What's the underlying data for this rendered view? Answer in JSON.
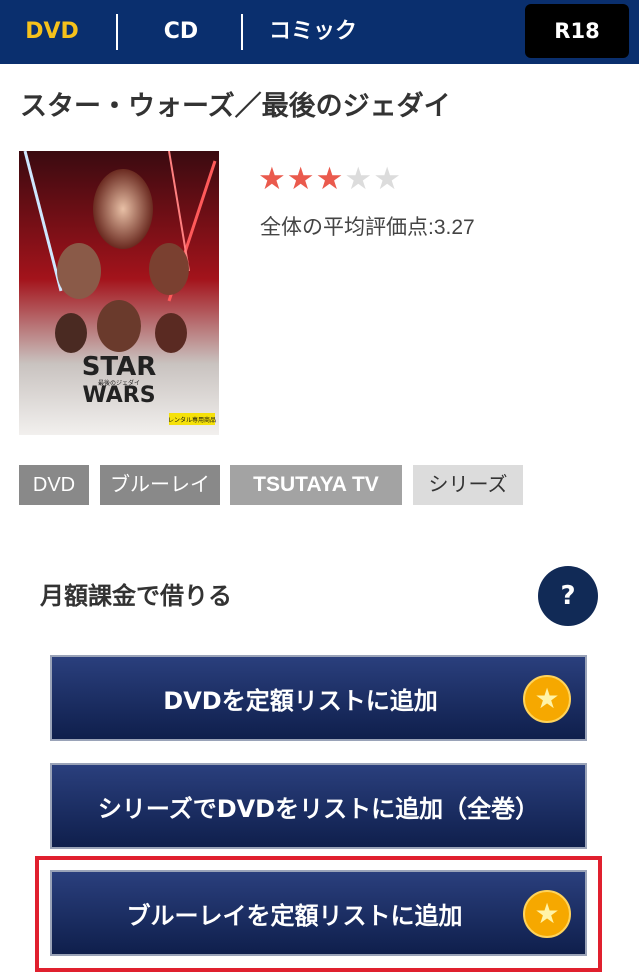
{
  "nav": {
    "tabs": [
      {
        "label": "DVD",
        "active": true
      },
      {
        "label": "CD",
        "active": false
      },
      {
        "label": "コミック",
        "active": false
      }
    ],
    "r18_label": "R18",
    "active_color": "#f6c21b",
    "bar_color": "#0a2f6e"
  },
  "product": {
    "title": "スター・ウォーズ／最後のジェダイ",
    "poster": {
      "brand_line1": "STAR",
      "brand_line2": "WARS",
      "subtitle": "最後のジェダイ",
      "sticker": "レンタル専用商品"
    },
    "rating": {
      "stars_filled": 3,
      "stars_total": 5,
      "average_text": "全体の平均評価点:3.27"
    },
    "tags": [
      "DVD",
      "ブルーレイ",
      "TSUTAYA TV",
      "シリーズ"
    ]
  },
  "monthly": {
    "heading": "月額課金で借りる",
    "help_label": "?",
    "buttons": [
      {
        "label": "DVDを定額リストに追加",
        "icon": "star-badge-icon"
      },
      {
        "label": "シリーズでDVDをリストに追加（全巻）"
      },
      {
        "label": "ブルーレイを定額リストに追加",
        "icon": "star-badge-icon",
        "highlighted": true
      }
    ],
    "highlight_color": "#e0202e"
  }
}
